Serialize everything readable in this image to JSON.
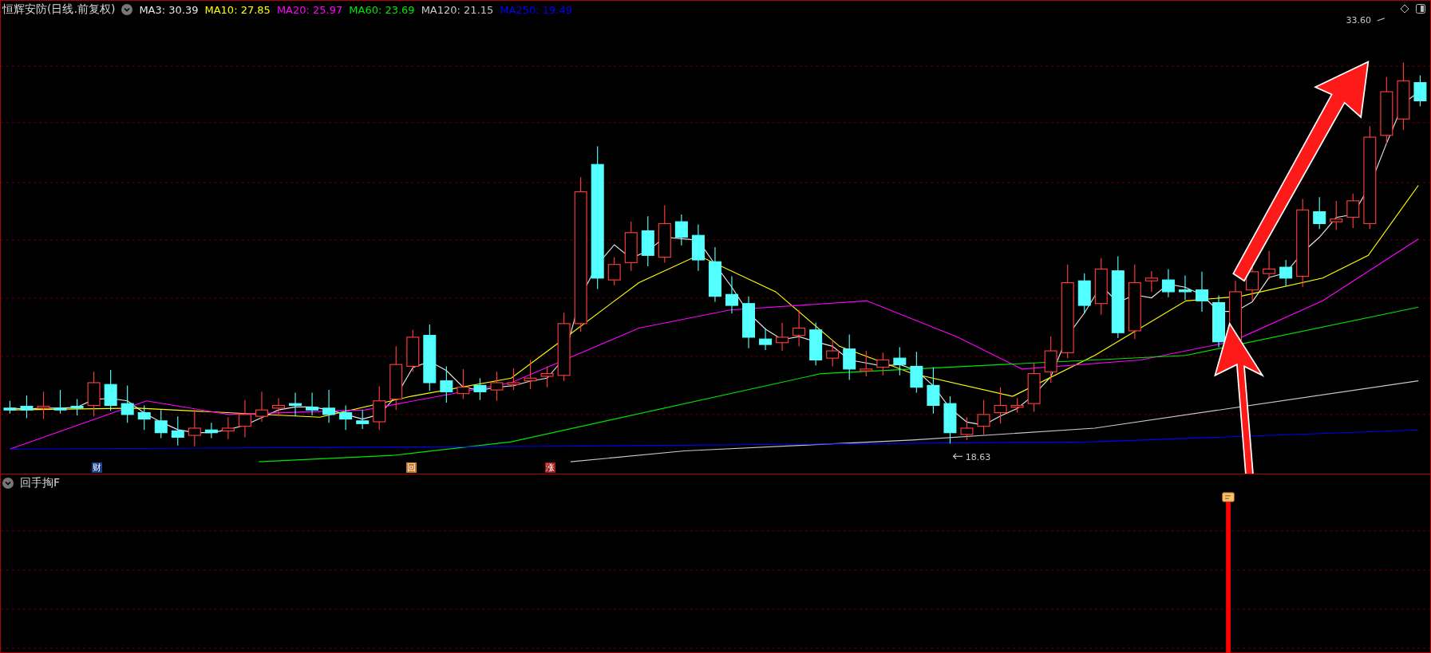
{
  "chart": {
    "title": "恒辉安防(日线.前复权)",
    "ma_legend": [
      {
        "label": "MA3: 30.39",
        "color": "#e6e6e6"
      },
      {
        "label": "MA10: 27.85",
        "color": "#ffff00"
      },
      {
        "label": "MA20: 25.97",
        "color": "#ff00ff"
      },
      {
        "label": "MA60: 23.69",
        "color": "#00e600"
      },
      {
        "label": "MA120: 21.15",
        "color": "#c8c8c8"
      },
      {
        "label": "MA250: 19.49",
        "color": "#0000ff"
      }
    ],
    "markers": [
      {
        "label": "财",
        "color": "#1c3f8c"
      },
      {
        "label": "回",
        "color": "#c8782a"
      },
      {
        "label": "涨",
        "color": "#a51818"
      }
    ],
    "high_label": "33.60",
    "low_label": "18.63"
  },
  "indicator_panel": {
    "title": "回手掏F"
  }
}
